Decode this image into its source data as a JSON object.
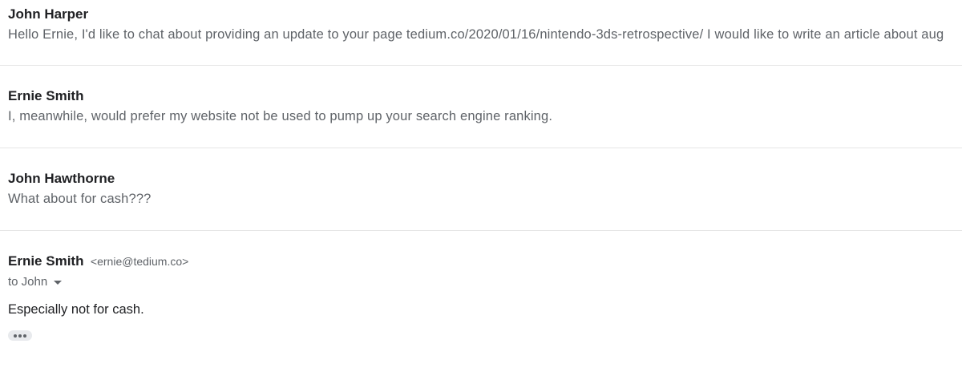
{
  "messages": [
    {
      "sender": "John Harper",
      "snippet": "Hello Ernie, I'd like to chat about providing an update to your page tedium.co/2020/01/16/nintendo-3ds-retrospective/ I would like to write an article about aug"
    },
    {
      "sender": "Ernie Smith",
      "snippet": "I, meanwhile, would prefer my website not be used to pump up your search engine ranking."
    },
    {
      "sender": "John Hawthorne",
      "snippet": "What about for cash???"
    }
  ],
  "expanded": {
    "sender": "Ernie Smith",
    "email": "<ernie@tedium.co>",
    "recipient": "to John",
    "body": "Especially not for cash.",
    "more_icon": "ellipsis-icon"
  }
}
